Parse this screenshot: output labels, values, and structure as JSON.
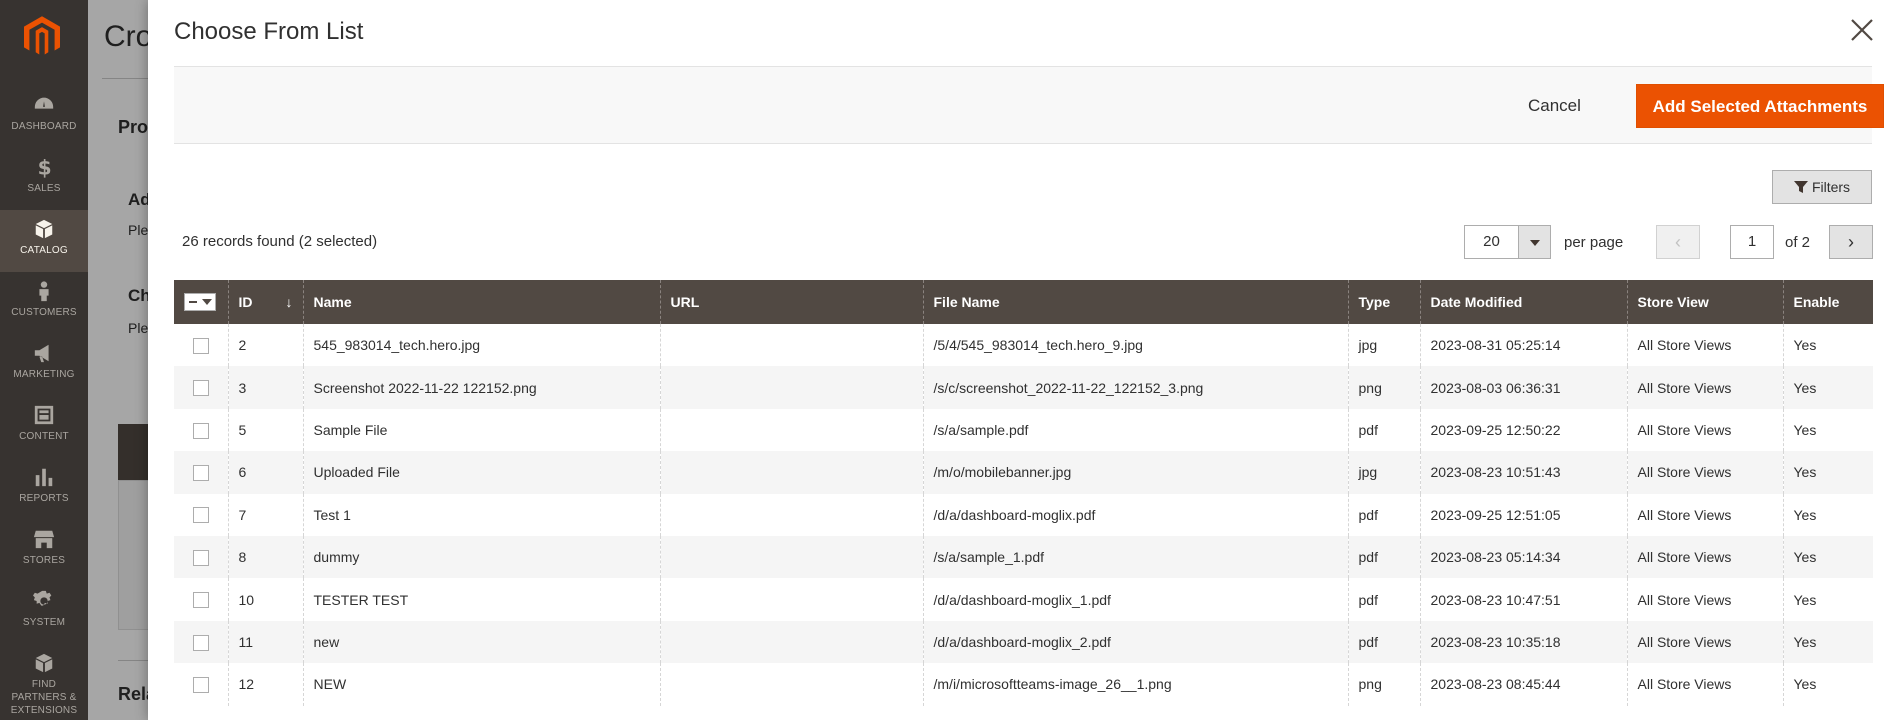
{
  "sidebar": {
    "items": [
      {
        "label": "DASHBOARD",
        "icon": "dashboard-icon"
      },
      {
        "label": "SALES",
        "icon": "dollar-icon"
      },
      {
        "label": "CATALOG",
        "icon": "catalog-box-icon"
      },
      {
        "label": "CUSTOMERS",
        "icon": "customers-icon"
      },
      {
        "label": "MARKETING",
        "icon": "megaphone-icon"
      },
      {
        "label": "CONTENT",
        "icon": "content-icon"
      },
      {
        "label": "REPORTS",
        "icon": "bar-chart-icon"
      },
      {
        "label": "STORES",
        "icon": "store-icon"
      },
      {
        "label": "SYSTEM",
        "icon": "gear-icon"
      },
      {
        "label": "FIND PARTNERS & EXTENSIONS",
        "icon": "partners-icon"
      }
    ],
    "active_index": 2
  },
  "background": {
    "title_fragment": "Cro",
    "section1": "Pro",
    "section2": "Ad",
    "text2": "Ple",
    "section3": "Ch",
    "text3": "Ple",
    "section4": "Rela"
  },
  "modal": {
    "title": "Choose From List",
    "cancel_label": "Cancel",
    "add_label": "Add Selected Attachments",
    "filters_label": "Filters",
    "records_text": "26 records found (2 selected)",
    "per_page_value": "20",
    "per_page_label": "per page",
    "page_input": "1",
    "page_of": "of 2",
    "prev_glyph": "‹",
    "next_glyph": "›"
  },
  "grid": {
    "columns": [
      "",
      "ID",
      "Name",
      "URL",
      "File Name",
      "Type",
      "Date Modified",
      "Store View",
      "Enable"
    ],
    "sort_glyph": "↓",
    "rows": [
      {
        "id": "2",
        "name": "545_983014_tech.hero.jpg",
        "url": "",
        "file": "/5/4/545_983014_tech.hero_9.jpg",
        "type": "jpg",
        "date": "2023-08-31 05:25:14",
        "store": "All Store Views",
        "enable": "Yes"
      },
      {
        "id": "3",
        "name": "Screenshot 2022-11-22 122152.png",
        "url": "",
        "file": "/s/c/screenshot_2022-11-22_122152_3.png",
        "type": "png",
        "date": "2023-08-03 06:36:31",
        "store": "All Store Views",
        "enable": "Yes"
      },
      {
        "id": "5",
        "name": "Sample File",
        "url": "",
        "file": "/s/a/sample.pdf",
        "type": "pdf",
        "date": "2023-09-25 12:50:22",
        "store": "All Store Views",
        "enable": "Yes"
      },
      {
        "id": "6",
        "name": "Uploaded File",
        "url": "",
        "file": "/m/o/mobilebanner.jpg",
        "type": "jpg",
        "date": "2023-08-23 10:51:43",
        "store": "All Store Views",
        "enable": "Yes"
      },
      {
        "id": "7",
        "name": "Test 1",
        "url": "",
        "file": "/d/a/dashboard-moglix.pdf",
        "type": "pdf",
        "date": "2023-09-25 12:51:05",
        "store": "All Store Views",
        "enable": "Yes"
      },
      {
        "id": "8",
        "name": "dummy",
        "url": "",
        "file": "/s/a/sample_1.pdf",
        "type": "pdf",
        "date": "2023-08-23 05:14:34",
        "store": "All Store Views",
        "enable": "Yes"
      },
      {
        "id": "10",
        "name": "TESTER TEST",
        "url": "",
        "file": "/d/a/dashboard-moglix_1.pdf",
        "type": "pdf",
        "date": "2023-08-23 10:47:51",
        "store": "All Store Views",
        "enable": "Yes"
      },
      {
        "id": "11",
        "name": "new",
        "url": "",
        "file": "/d/a/dashboard-moglix_2.pdf",
        "type": "pdf",
        "date": "2023-08-23 10:35:18",
        "store": "All Store Views",
        "enable": "Yes"
      },
      {
        "id": "12",
        "name": "NEW",
        "url": "",
        "file": "/m/i/microsoftteams-image_26__1.png",
        "type": "png",
        "date": "2023-08-23 08:45:44",
        "store": "All Store Views",
        "enable": "Yes"
      }
    ]
  },
  "colors": {
    "accent": "#eb5202",
    "sidebar_bg": "#373330",
    "header_bg": "#514943"
  }
}
